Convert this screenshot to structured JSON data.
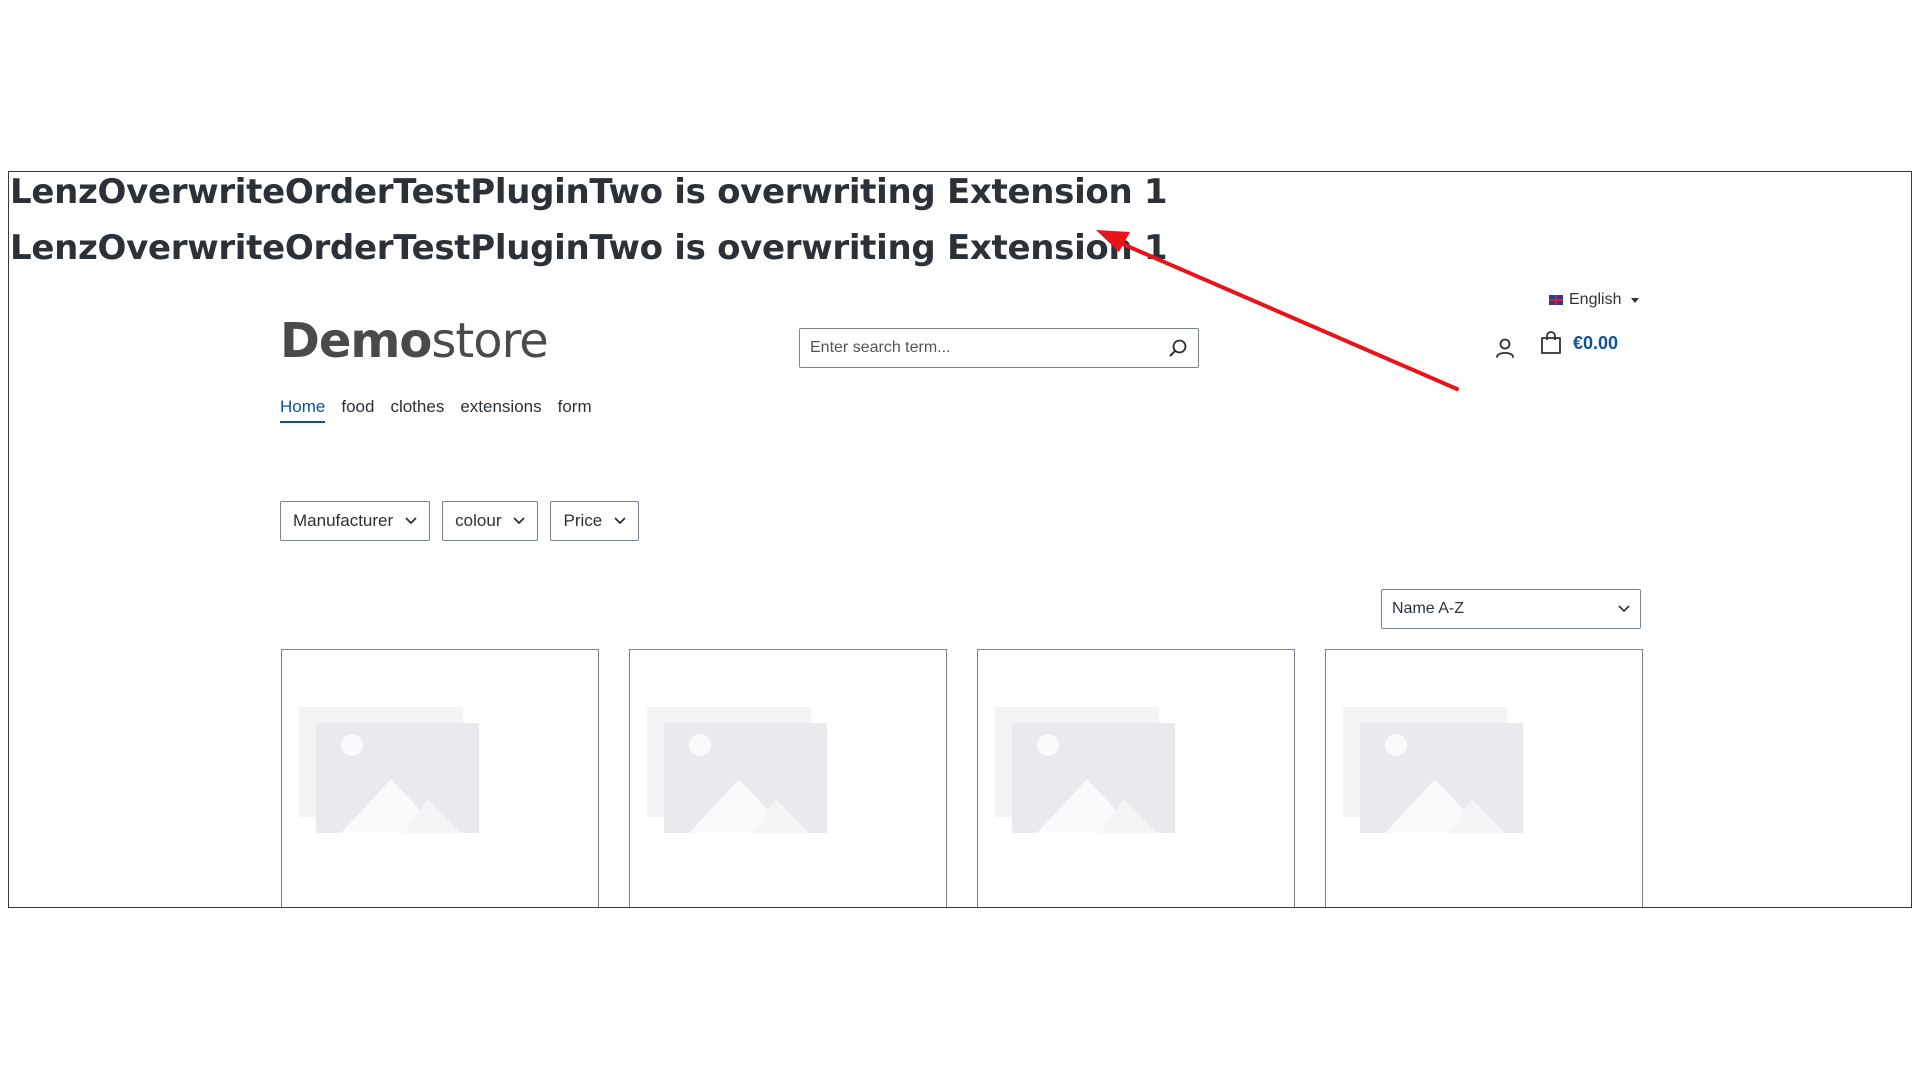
{
  "overwrite_messages": [
    "LenzOverwriteOrderTestPluginTwo is overwriting Extension 1",
    "LenzOverwriteOrderTestPluginTwo is overwriting Extension 1"
  ],
  "language": {
    "label": "English",
    "flag_icon": "uk-flag-icon"
  },
  "logo": {
    "bold": "Demo",
    "regular": "store"
  },
  "search": {
    "placeholder": "Enter search term...",
    "value": ""
  },
  "cart": {
    "total": "€0.00"
  },
  "nav": {
    "items": [
      "Home",
      "food",
      "clothes",
      "extensions",
      "form"
    ],
    "active": "Home"
  },
  "filters": [
    "Manufacturer",
    "colour",
    "Price"
  ],
  "sorting": {
    "selected": "Name A-Z"
  },
  "colors": {
    "accent": "#0b539b",
    "annotation_arrow": "#e8141c",
    "placeholder_bg": "#e9eaee"
  }
}
